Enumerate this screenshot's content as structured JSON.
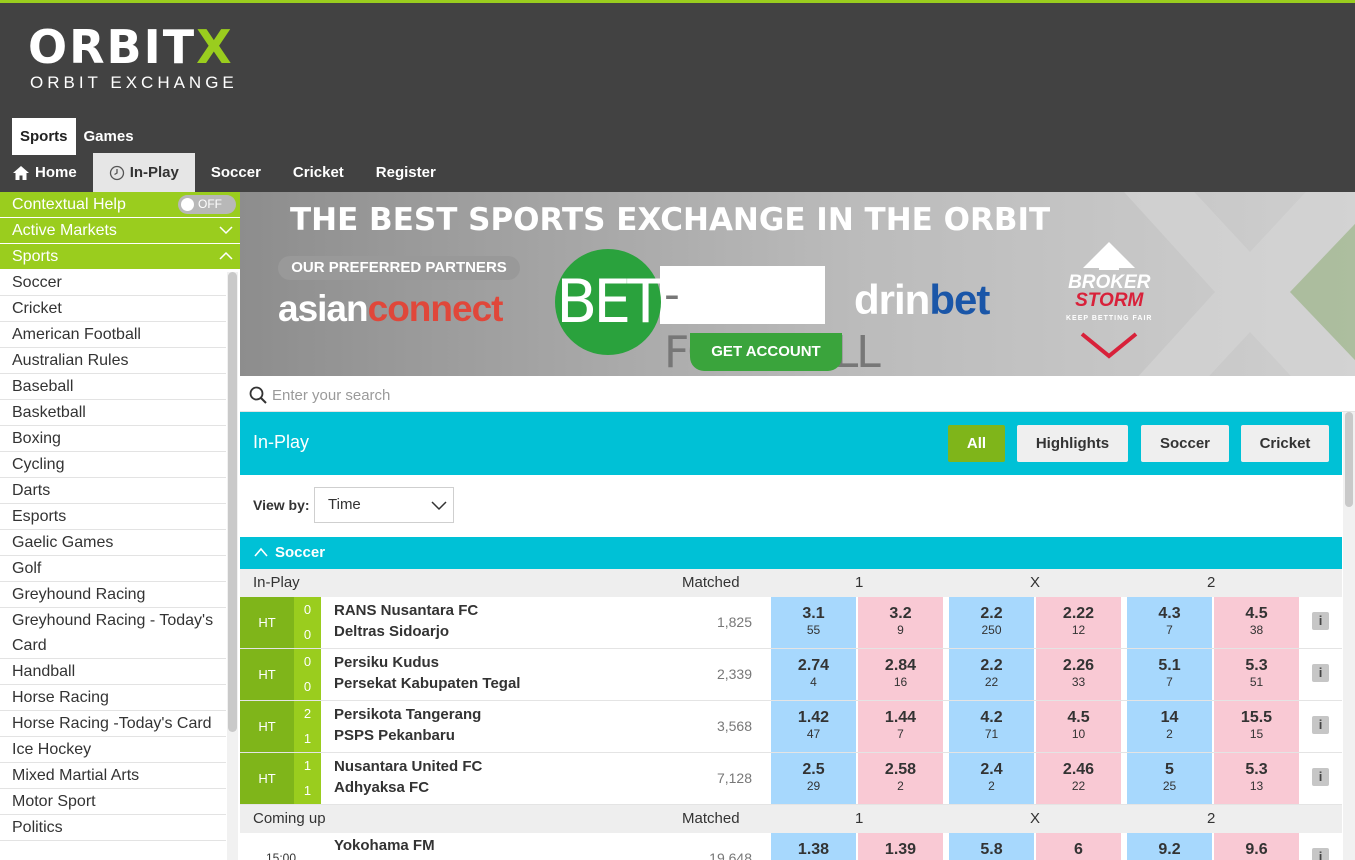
{
  "logo": {
    "main_a": "ORBIT",
    "main_b": "X",
    "sub": "ORBIT EXCHANGE"
  },
  "tabs": [
    {
      "label": "Sports",
      "active": true
    },
    {
      "label": "Games",
      "active": false
    }
  ],
  "nav": [
    {
      "label": "Home",
      "icon": "home-icon"
    },
    {
      "label": "In-Play",
      "icon": "clock-icon",
      "active": true
    },
    {
      "label": "Soccer"
    },
    {
      "label": "Cricket"
    },
    {
      "label": "Register"
    }
  ],
  "sidebar": {
    "contextual_help": "Contextual Help",
    "toggle": "OFF",
    "active_markets": "Active Markets",
    "sports": "Sports",
    "items": [
      "Soccer",
      "Cricket",
      "American Football",
      "Australian Rules",
      "Baseball",
      "Basketball",
      "Boxing",
      "Cycling",
      "Darts",
      "Esports",
      "Gaelic Games",
      "Golf",
      "Greyhound Racing",
      "Greyhound Racing - Today's Card",
      "Handball",
      "Horse Racing",
      "Horse Racing -Today's Card",
      "Ice Hockey",
      "Mixed Martial Arts",
      "Motor Sport",
      "Politics"
    ]
  },
  "banner": {
    "title": "THE BEST SPORTS EXCHANGE IN THE ORBIT",
    "partners": "OUR PREFERRED PARTNERS",
    "asian_a": "asian",
    "asian_b": "connect",
    "bet": "BET",
    "football": "-FOOTBALL",
    "get_account": "GET ACCOUNT",
    "drin": "drin",
    "drin_bet": "bet",
    "broker_a": "BROKER",
    "broker_b": "STORM",
    "broker_tag": "KEEP BETTING FAIR"
  },
  "search": {
    "placeholder": "Enter your search",
    "value": ""
  },
  "inplay": {
    "title": "In-Play",
    "filters": [
      "All",
      "Highlights",
      "Soccer",
      "Cricket"
    ],
    "view_by_label": "View by:",
    "view_by_value": "Time"
  },
  "section": {
    "title": "Soccer",
    "head_inplay": {
      "label": "In-Play",
      "matched": "Matched",
      "c1": "1",
      "cx": "X",
      "c2": "2"
    },
    "head_coming": {
      "label": "Coming up",
      "matched": "Matched",
      "c1": "1",
      "cx": "X",
      "c2": "2"
    },
    "rows": [
      {
        "status": "HT",
        "s1": "0",
        "s2": "0",
        "home": "RANS Nusantara FC",
        "away": "Deltras Sidoarjo",
        "matched": "1,825",
        "odds": [
          [
            "3.1",
            "55"
          ],
          [
            "3.2",
            "9"
          ],
          [
            "2.2",
            "250"
          ],
          [
            "2.22",
            "12"
          ],
          [
            "4.3",
            "7"
          ],
          [
            "4.5",
            "38"
          ]
        ]
      },
      {
        "status": "HT",
        "s1": "0",
        "s2": "0",
        "home": "Persiku Kudus",
        "away": "Persekat Kabupaten Tegal",
        "matched": "2,339",
        "odds": [
          [
            "2.74",
            "4"
          ],
          [
            "2.84",
            "16"
          ],
          [
            "2.2",
            "22"
          ],
          [
            "2.26",
            "33"
          ],
          [
            "5.1",
            "7"
          ],
          [
            "5.3",
            "51"
          ]
        ]
      },
      {
        "status": "HT",
        "s1": "2",
        "s2": "1",
        "home": "Persikota Tangerang",
        "away": "PSPS Pekanbaru",
        "matched": "3,568",
        "odds": [
          [
            "1.42",
            "47"
          ],
          [
            "1.44",
            "7"
          ],
          [
            "4.2",
            "71"
          ],
          [
            "4.5",
            "10"
          ],
          [
            "14",
            "2"
          ],
          [
            "15.5",
            "15"
          ]
        ]
      },
      {
        "status": "HT",
        "s1": "1",
        "s2": "1",
        "home": "Nusantara United FC",
        "away": "Adhyaksa FC",
        "matched": "7,128",
        "odds": [
          [
            "2.5",
            "29"
          ],
          [
            "2.58",
            "2"
          ],
          [
            "2.4",
            "2"
          ],
          [
            "2.46",
            "22"
          ],
          [
            "5",
            "25"
          ],
          [
            "5.3",
            "13"
          ]
        ]
      }
    ],
    "coming": {
      "time": "15:00",
      "home": "Yokohama FM",
      "matched": "19,648",
      "odds": [
        "1.38",
        "1.39",
        "5.8",
        "6",
        "9.2",
        "9.6"
      ]
    },
    "info_label": "i"
  },
  "colors": {
    "accent_green": "#9acd1e",
    "cyan": "#00c1d6",
    "back": "#a7d8fd",
    "lay": "#f9c9d4",
    "header": "#424242"
  }
}
